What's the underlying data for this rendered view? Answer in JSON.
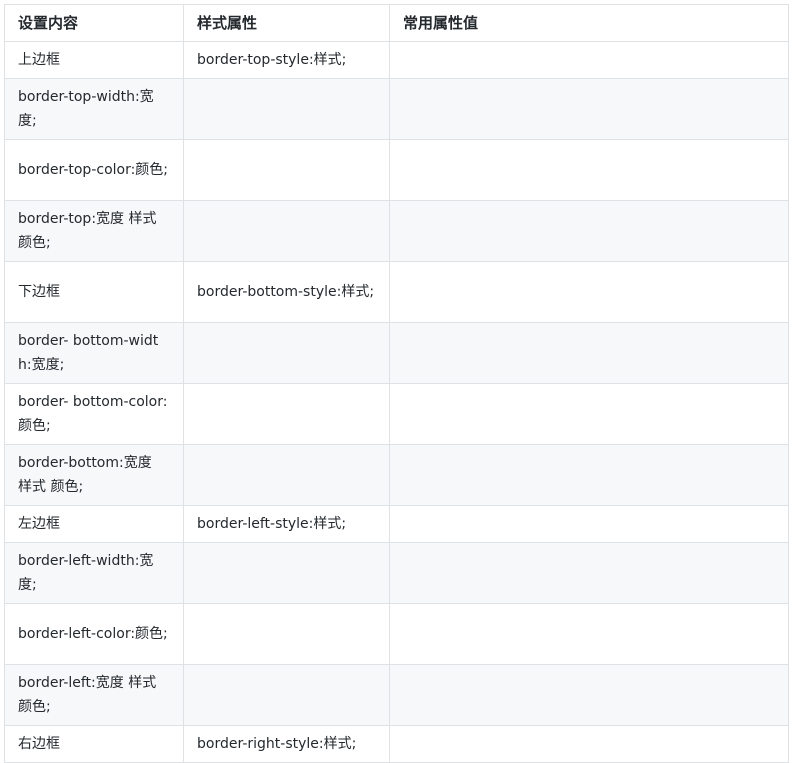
{
  "table": {
    "headers": [
      "设置内容",
      "样式属性",
      "常用属性值"
    ],
    "rows": [
      [
        "上边框",
        "border-top-style:样式;",
        ""
      ],
      [
        "border-top-width:宽度;",
        "",
        ""
      ],
      [
        "border-top-color:颜色;",
        "",
        ""
      ],
      [
        "border-top:宽度 样式 颜色;",
        "",
        ""
      ],
      [
        "下边框",
        "border-bottom-style:样式;",
        ""
      ],
      [
        "border- bottom-width:宽度;",
        "",
        ""
      ],
      [
        "border- bottom-color:颜色;",
        "",
        ""
      ],
      [
        "border-bottom:宽度 样式 颜色;",
        "",
        ""
      ],
      [
        "左边框",
        "border-left-style:样式;",
        ""
      ],
      [
        "border-left-width:宽度;",
        "",
        ""
      ],
      [
        "border-left-color:颜色;",
        "",
        ""
      ],
      [
        "border-left:宽度 样式 颜色;",
        "",
        ""
      ],
      [
        "右边框",
        "border-right-style:样式;",
        ""
      ]
    ]
  }
}
